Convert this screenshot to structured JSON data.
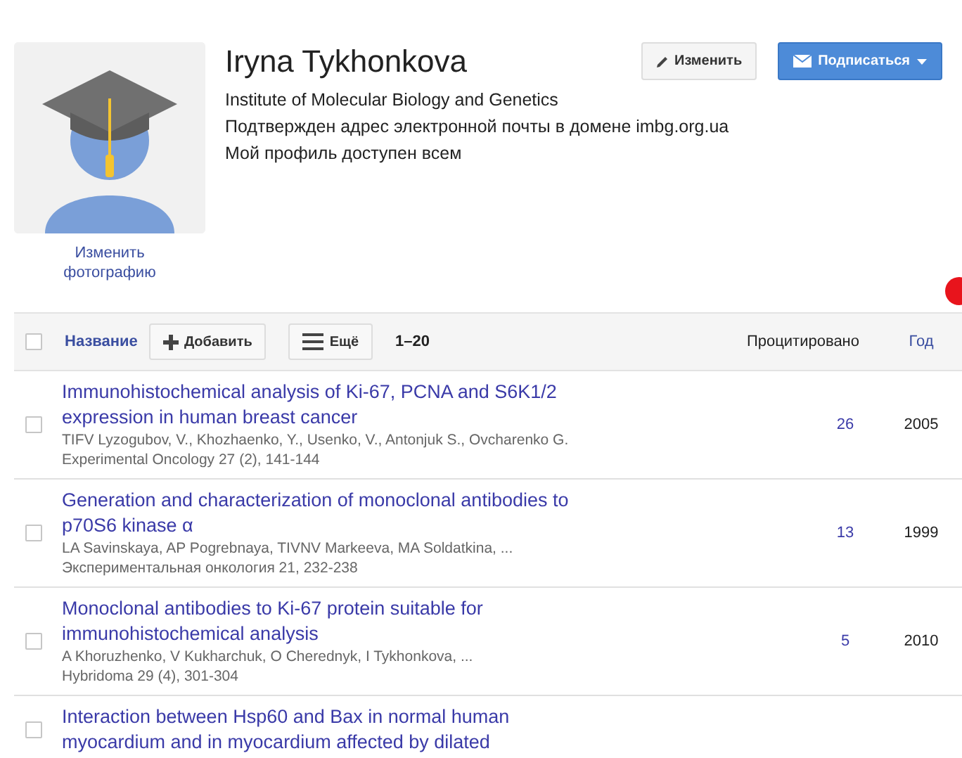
{
  "profile": {
    "name": "Iryna Tykhonkova",
    "affiliation": "Institute of Molecular Biology and Genetics",
    "email_note": "Подтвержден адрес электронной почты в домене imbg.org.ua",
    "visibility": "Мой профиль доступен всем",
    "change_photo": "Изменить фотографию"
  },
  "buttons": {
    "edit": "Изменить",
    "follow": "Подписаться"
  },
  "toolbar": {
    "select_all_checked": false,
    "title_column": "Название",
    "add": "Добавить",
    "more": "Ещё",
    "range": "1–20",
    "cited_column": "Процитировано",
    "year_column": "Год"
  },
  "articles": [
    {
      "title": "Immunohistochemical analysis of Ki-67, PCNA and S6K1/2 expression in human breast cancer",
      "authors": "TIFV Lyzogubov, V., Khozhaenko, Y., Usenko, V., Antonjuk S., Ovcharenko G.",
      "source": "Experimental Oncology 27 (2), 141-144",
      "cited": "26",
      "year": "2005",
      "checked": false
    },
    {
      "title": "Generation and characterization of monoclonal antibodies to p70S6 kinase α",
      "authors": "LA Savinskaya, AP Pogrebnaya, TIVNV Markeeva, MA Soldatkina, ...",
      "source": "Экспериментальная онкология 21, 232-238",
      "cited": "13",
      "year": "1999",
      "checked": false
    },
    {
      "title": "Monoclonal antibodies to Ki-67 protein suitable for immunohistochemical analysis",
      "authors": "A Khoruzhenko, V Kukharchuk, O Cherednyk, I Tykhonkova, ...",
      "source": "Hybridoma 29 (4), 301-304",
      "cited": "5",
      "year": "2010",
      "checked": false
    },
    {
      "title": "Interaction between Hsp60 and Bax in normal human myocardium and in myocardium affected by dilated",
      "checked": false
    }
  ]
}
